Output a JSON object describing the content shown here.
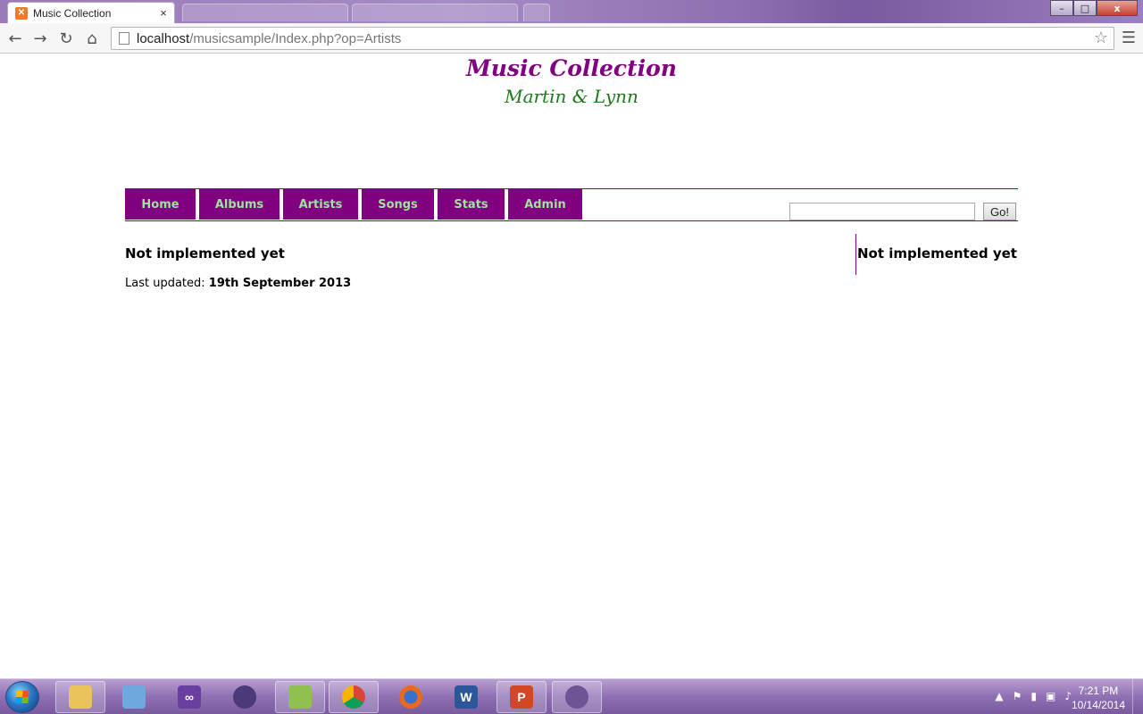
{
  "browser": {
    "active_tab_title": "Music Collection",
    "tab_close_glyph": "×",
    "url_host": "localhost",
    "url_path": "/musicsample/Index.php?op=Artists",
    "window_buttons": {
      "minimize": "–",
      "maximize": "□",
      "close": "x"
    }
  },
  "site": {
    "title": "Music Collection",
    "subtitle": "Martin & Lynn"
  },
  "nav": {
    "items": [
      {
        "label": "Home"
      },
      {
        "label": "Albums"
      },
      {
        "label": "Artists"
      },
      {
        "label": "Songs"
      },
      {
        "label": "Stats"
      },
      {
        "label": "Admin"
      }
    ],
    "search_value": "",
    "go_label": "Go!"
  },
  "content": {
    "heading": "Not implemented yet",
    "last_updated_label": "Last updated:",
    "last_updated_date": "19th September 2013"
  },
  "sidebar": {
    "heading": "Not implemented yet"
  },
  "taskbar": {
    "apps": [
      {
        "name": "file-explorer-icon"
      },
      {
        "name": "virtualbox-icon"
      },
      {
        "name": "visual-studio-icon"
      },
      {
        "name": "eclipse-icon"
      },
      {
        "name": "notepad-plus-plus-icon"
      },
      {
        "name": "chrome-icon"
      },
      {
        "name": "firefox-icon"
      },
      {
        "name": "word-icon",
        "glyph": "W"
      },
      {
        "name": "powerpoint-icon",
        "glyph": "P"
      },
      {
        "name": "github-icon"
      }
    ],
    "time": "7:21 PM",
    "date": "10/14/2014"
  },
  "colors": {
    "brand_purple": "#800080",
    "nav_text_green": "#9ee39e",
    "subtitle_green": "#1b7a1b"
  }
}
